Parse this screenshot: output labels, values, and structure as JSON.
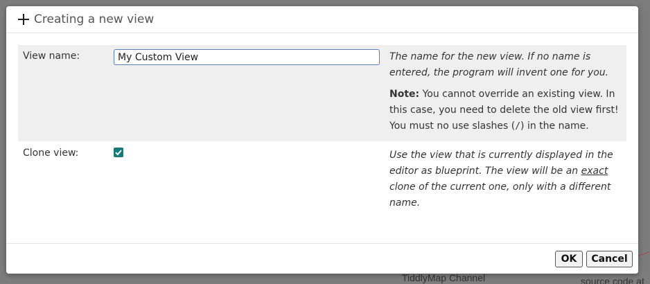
{
  "dialog": {
    "title": "Creating a new view",
    "icon": "plus-icon"
  },
  "form": {
    "view_name": {
      "label": "View name:",
      "value": "My Custom View",
      "help": "The name for the new view. If no name is entered, the program will invent one for you.",
      "note_label": "Note:",
      "note_before_code": "You cannot override an existing view. In this case, you need to delete the old view first! You must no use slashes (",
      "note_code": "/",
      "note_after_code": ") in the name."
    },
    "clone_view": {
      "label": "Clone view:",
      "checked": true,
      "help_before": "Use the view that is currently displayed in the editor as blueprint. The view will be an ",
      "help_emphasis": "exact",
      "help_after": " clone of the current one, only with a different name."
    }
  },
  "buttons": {
    "ok": "OK",
    "cancel": "Cancel"
  },
  "background": {
    "channel_text": "TiddlyMap Channel",
    "source_text": "source code at"
  },
  "colors": {
    "checkbox": "#127c7a",
    "input_border": "#5a7dbe",
    "row_highlight": "#efefef"
  }
}
